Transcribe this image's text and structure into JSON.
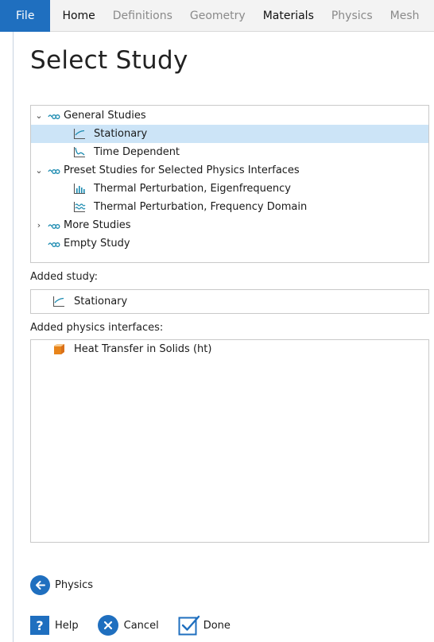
{
  "ribbon": {
    "tabs": [
      "File",
      "Home",
      "Definitions",
      "Geometry",
      "Materials",
      "Physics",
      "Mesh"
    ]
  },
  "page_title": "Select Study",
  "tree": {
    "items": [
      {
        "label": "General Studies",
        "icon": "study-group-icon",
        "expanded": true
      },
      {
        "label": "Stationary",
        "icon": "stationary-icon",
        "selected": true
      },
      {
        "label": "Time Dependent",
        "icon": "time-dependent-icon"
      },
      {
        "label": "Preset Studies for Selected Physics Interfaces",
        "icon": "study-group-icon",
        "expanded": true
      },
      {
        "label": "Thermal Perturbation, Eigenfrequency",
        "icon": "eigenfrequency-icon"
      },
      {
        "label": "Thermal Perturbation, Frequency Domain",
        "icon": "frequency-domain-icon"
      },
      {
        "label": "More Studies",
        "icon": "study-group-icon",
        "expanded": false
      },
      {
        "label": "Empty Study",
        "icon": "study-group-icon"
      }
    ]
  },
  "added_study": {
    "label": "Added study:",
    "value": "Stationary",
    "icon": "stationary-icon"
  },
  "added_physics": {
    "label": "Added physics interfaces:",
    "items": [
      {
        "label": "Heat Transfer in Solids (ht)",
        "icon": "heat-transfer-icon"
      }
    ]
  },
  "nav": {
    "back_label": "Physics"
  },
  "footer": {
    "help": "Help",
    "cancel": "Cancel",
    "done": "Done"
  },
  "colors": {
    "accent": "#1f6fbf",
    "selection": "#cce4f7",
    "study_icon": "#1a8ab0",
    "heat_icon": "#e8841a"
  }
}
